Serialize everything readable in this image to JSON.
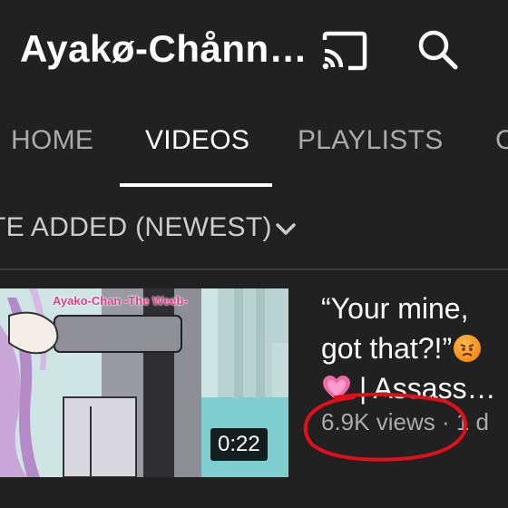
{
  "header": {
    "channel_title": "Ayakø-Chånn…"
  },
  "tabs": [
    {
      "label": "HOME",
      "active": false
    },
    {
      "label": "VIDEOS",
      "active": true
    },
    {
      "label": "PLAYLISTS",
      "active": false
    },
    {
      "label": "C",
      "active": false
    }
  ],
  "sort": {
    "label": "TE ADDED (NEWEST)"
  },
  "video": {
    "thumbnail_watermark": "Ayako-Chan -The Weeb-",
    "duration": "0:22",
    "title_line1": "“Your mine,",
    "title_line2": "got that?!”",
    "title_line3": "| Assass…",
    "views": "6.9K views",
    "age": "· 1 d"
  },
  "icons": {
    "cast": "cast-icon",
    "search": "search-icon",
    "sort_chevron": "chevron-down-icon",
    "angry": "angry-face-emoji",
    "heart": "pink-heart-emoji"
  },
  "colors": {
    "background": "#212121",
    "text_primary": "#ffffff",
    "text_secondary": "#aaaaaa",
    "annotation": "#e0101a"
  }
}
